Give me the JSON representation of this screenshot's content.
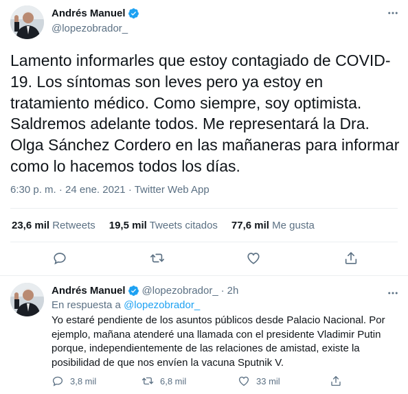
{
  "main_tweet": {
    "name": "Andrés Manuel",
    "handle": "@lopezobrador_",
    "text": "Lamento informarles que estoy contagiado de COVID-19. Los síntomas son leves pero ya estoy en tratamiento médico. Como siempre, soy optimista. Saldremos adelante todos. Me representará la Dra. Olga Sánchez Cordero en las mañaneras para informar como lo hacemos todos los días.",
    "time": "6:30 p. m.",
    "sep": "·",
    "date": "24 ene. 2021",
    "app": "Twitter Web App",
    "stats": {
      "retweets_value": "23,6 mil",
      "retweets_label": "Retweets",
      "quotes_value": "19,5 mil",
      "quotes_label": "Tweets citados",
      "likes_value": "77,6 mil",
      "likes_label": "Me gusta"
    }
  },
  "reply_tweet": {
    "name": "Andrés Manuel",
    "handle": "@lopezobrador_",
    "dot": "·",
    "time": "2h",
    "replying_prefix": "En respuesta a",
    "replying_to": "@lopezobrador_",
    "text": "Yo estaré pendiente de los asuntos públicos desde Palacio Nacional. Por ejemplo, mañana atenderé una llamada con el presidente Vladimir Putin porque, independientemente de las relaciones de amistad, existe la posibilidad de que nos envíen la vacuna Sputnik V.",
    "replies": "3,8 mil",
    "retweets": "6,8 mil",
    "likes": "33 mil"
  },
  "icons": {
    "verified": "verified-badge-icon",
    "more": "more-horizontal-icon",
    "reply": "reply-icon",
    "retweet": "retweet-icon",
    "like": "heart-icon",
    "share": "share-icon"
  },
  "colors": {
    "text": "#0f1419",
    "secondary": "#5b7083",
    "accent": "#1da1f2",
    "divider": "#ebeef0"
  }
}
